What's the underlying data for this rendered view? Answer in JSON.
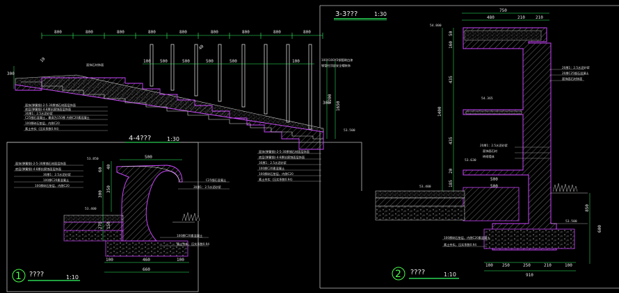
{
  "colors": {
    "background": "#000000",
    "dimension": "#33ff66",
    "outline": "#cc44ff",
    "hatch": "#aaaaaa",
    "frame": "#bfbfbf",
    "text": "#e8e8e8"
  },
  "section_33": {
    "title": "3-3???",
    "scale": "1:30"
  },
  "section_44": {
    "title": "4-4???",
    "scale": "1:30"
  },
  "detail_1": {
    "number": "1",
    "title": "????",
    "scale": "1:10"
  },
  "detail_2": {
    "number": "2",
    "title": "????",
    "scale": "1:10"
  },
  "stair_dims": {
    "top": [
      "800",
      "800",
      "800",
      "800",
      "800",
      "800",
      "800",
      "800",
      "800"
    ],
    "rail": [
      "100",
      "500",
      "500",
      "500",
      "500",
      "100"
    ],
    "right": [
      "300",
      "1200",
      "1650"
    ],
    "left": "300",
    "railing_tag": "40",
    "slope_tag": "10"
  },
  "stair_notes": {
    "rail_note_1": "100X100X5钢管刷白漆",
    "rail_note_2": "钢管柱顶部安全帽装饰",
    "stone": "面饰石材饰面",
    "layers": [
      "面饰(弹簧钢)-2-5-30厚铺石材面层饰面",
      "底层(弹簧钢)-4-8厚抗腐蚀面层饰面",
      "30厚1：2.5水泥砂浆",
      "C25细石混凝土，最高为150厚  内侧C20素混凝土",
      "100厚碎石垫层，内侧C20",
      "素土夯实（压实系数0.94）"
    ],
    "right_layers": [
      "面饰(弹簧钢)-2-5-30厚铺石材面层饰面",
      "底层(弹簧钢)-4-8厚抗腐蚀面层饰面",
      "30厚1：2.5水泥砂浆",
      "100厚C20素混凝土",
      "100厚碎石垫层，内侧C20",
      "素土夯实（压实系数0.94）"
    ],
    "elev": "53.500"
  },
  "bench_dims": {
    "top": "500",
    "left": [
      "60",
      "40",
      "350",
      "300",
      "275",
      "150"
    ],
    "bottom": [
      "100",
      "460",
      "100"
    ],
    "total": "660",
    "elev_top": "53.850",
    "elev_seat": "53.400"
  },
  "bench_notes": [
    "面饰(弹簧钢)-2-5-30厚铺石材面层饰面",
    "底层(弹簧钢)-4-8厚抗腐蚀面层饰面",
    "30厚1：2.5水泥砂浆",
    "100厚C20素混凝土",
    "100厚碎石垫层，内侧C20",
    "C25细石混凝土",
    "30厚1：2.5水泥砂浆",
    "100厚C20素混凝土",
    "素土夯实，压实系数0.94"
  ],
  "wall_dims": {
    "top_total": "750",
    "top": [
      "480",
      "210",
      "210"
    ],
    "left": [
      "50",
      "160",
      "435",
      "1400",
      "435",
      "20",
      "185"
    ],
    "bottom": [
      "100",
      "250",
      "250",
      "210",
      "100"
    ],
    "total": "910",
    "inner": [
      "500",
      "500"
    ],
    "right": [
      "850",
      "600"
    ],
    "elev_top": "54.800",
    "elev_mid": "54.365",
    "elev_low": "53.630",
    "elev_ground": "53.400",
    "elev_right": "53.500"
  },
  "wall_notes": {
    "right_1": "20厚1：2.5水泥砂浆",
    "right_2": "20厚C25细石混凝土",
    "right_3": "面饰面石材饰面",
    "inner_1": "20厚1：2.5水泥砂浆",
    "inner_2": "面饰面石材",
    "inner_3": "砖砌墙体",
    "bottom_1": "100厚碎石垫层，内侧C20素混凝土",
    "bottom_2": "素土夯实，压实系数0.94"
  }
}
